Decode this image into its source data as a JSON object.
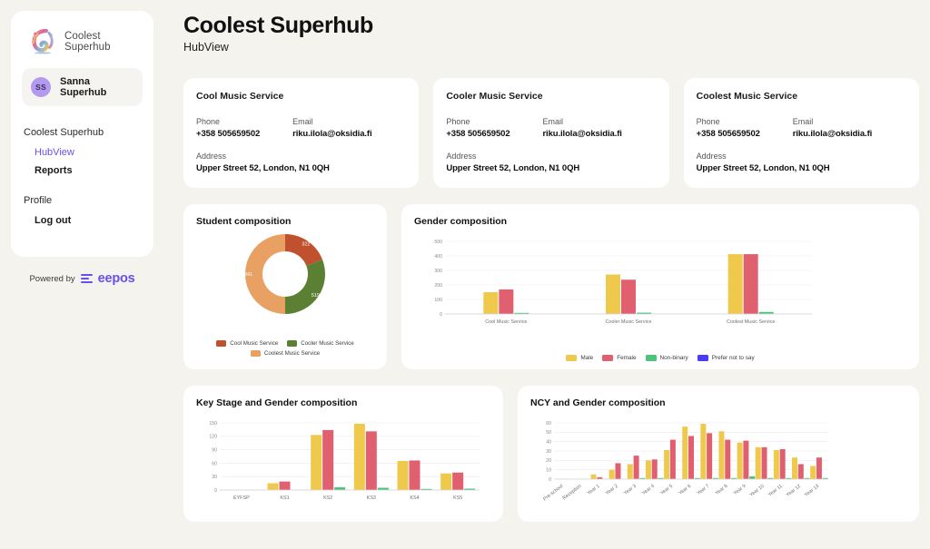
{
  "sidebar": {
    "brand": {
      "name": "Coolest Superhub",
      "logo_icon": "superhub-swirl-logo"
    },
    "user": {
      "initials": "SS",
      "name": "Sanna Superhub"
    },
    "groups": [
      {
        "heading": "Coolest Superhub",
        "items": [
          {
            "label": "HubView",
            "active": true
          },
          {
            "label": "Reports",
            "active": false
          }
        ]
      },
      {
        "heading": "Profile",
        "items": [
          {
            "label": "Log out",
            "active": false
          }
        ]
      }
    ],
    "footer": {
      "powered_label": "Powered by",
      "vendor": "eepos",
      "vendor_color": "#6b4ef0"
    }
  },
  "header": {
    "title": "Coolest Superhub",
    "subtitle": "HubView"
  },
  "contacts": {
    "labels": {
      "phone": "Phone",
      "email": "Email",
      "address": "Address"
    },
    "cards": [
      {
        "title": "Cool Music Service",
        "phone": "+358 505659502",
        "email": "riku.ilola@oksidia.fi",
        "address": "Upper Street 52, London, N1 0QH"
      },
      {
        "title": "Cooler Music Service",
        "phone": "+358 505659502",
        "email": "riku.ilola@oksidia.fi",
        "address": "Upper Street 52, London, N1 0QH"
      },
      {
        "title": "Coolest Music Service",
        "phone": "+358 505659502",
        "email": "riku.ilola@oksidia.fi",
        "address": "Upper Street 52, London, N1 0QH"
      }
    ]
  },
  "palette": {
    "male": "#efc košik",
    "bg": "#f4f3ee",
    "card": "#ffffff",
    "accent": "#6b4ef0"
  },
  "chart_data": [
    {
      "id": "student-composition",
      "type": "pie",
      "title": "Student composition",
      "donut": true,
      "categories": [
        "Cool Music Service",
        "Cooler Music Service",
        "Coolest Music Service"
      ],
      "values": [
        322,
        519,
        841
      ],
      "colors": [
        "#c0512f",
        "#5b8033",
        "#e9a063"
      ],
      "legend_position": "bottom"
    },
    {
      "id": "gender-composition",
      "type": "bar",
      "title": "Gender composition",
      "categories": [
        "Cool Music Service",
        "Cooler Music Service",
        "Coolest Music Service"
      ],
      "series": [
        {
          "name": "Male",
          "color": "#efc94c",
          "values": [
            150,
            272,
            412
          ]
        },
        {
          "name": "Female",
          "color": "#e06070",
          "values": [
            169,
            236,
            412
          ]
        },
        {
          "name": "Non-binary",
          "color": "#4cc47c",
          "values": [
            3,
            9,
            14
          ]
        },
        {
          "name": "Prefer not to say",
          "color": "#4b3bf5",
          "values": [
            0,
            0,
            0
          ]
        }
      ],
      "ylim": [
        0,
        500
      ],
      "yticks": [
        0,
        100,
        200,
        300,
        400,
        500
      ],
      "xlabel": "",
      "ylabel": "",
      "grid": true,
      "legend_position": "bottom"
    },
    {
      "id": "key-stage-gender-composition",
      "type": "bar",
      "title": "Key Stage and Gender composition",
      "categories": [
        "EYFSP",
        "KS1",
        "KS2",
        "KS3",
        "KS4",
        "KS5"
      ],
      "series": [
        {
          "name": "Male",
          "color": "#efc94c",
          "values": [
            0,
            15,
            123,
            148,
            65,
            37
          ]
        },
        {
          "name": "Female",
          "color": "#e06070",
          "values": [
            0,
            19,
            134,
            131,
            66,
            39
          ]
        },
        {
          "name": "Non-binary",
          "color": "#4cc47c",
          "values": [
            0,
            0,
            6,
            5,
            2,
            3
          ]
        },
        {
          "name": "Prefer not to say",
          "color": "#4b3bf5",
          "values": [
            0,
            0,
            0,
            0,
            0,
            0
          ]
        }
      ],
      "ylim": [
        0,
        150
      ],
      "yticks": [
        0,
        30,
        60,
        90,
        120,
        150
      ],
      "grid": true
    },
    {
      "id": "ncy-gender-composition",
      "type": "bar",
      "title": "NCY and Gender composition",
      "categories": [
        "Pre-school",
        "Reception",
        "Year 1",
        "Year 2",
        "Year 3",
        "Year 4",
        "Year 5",
        "Year 6",
        "Year 7",
        "Year 8",
        "Year 9",
        "Year 10",
        "Year 11",
        "Year 12",
        "Year 13"
      ],
      "series": [
        {
          "name": "Male",
          "color": "#efc94c",
          "values": [
            0,
            0,
            5,
            10,
            16,
            20,
            31,
            56,
            59,
            51,
            39,
            34,
            31,
            23,
            14
          ]
        },
        {
          "name": "Female",
          "color": "#e06070",
          "values": [
            0,
            0,
            2,
            17,
            25,
            21,
            42,
            46,
            49,
            42,
            41,
            34,
            32,
            16,
            23
          ]
        },
        {
          "name": "Non-binary",
          "color": "#4cc47c",
          "values": [
            0,
            0,
            0,
            0,
            1,
            1,
            0,
            1,
            1,
            1,
            3,
            1,
            1,
            1,
            1
          ]
        },
        {
          "name": "Prefer not to say",
          "color": "#4b3bf5",
          "values": [
            0,
            0,
            0,
            0,
            0,
            0,
            0,
            0,
            0,
            0,
            0,
            0,
            0,
            0,
            0
          ]
        }
      ],
      "ylim": [
        0,
        60
      ],
      "yticks": [
        0,
        10,
        20,
        30,
        40,
        50,
        60
      ],
      "grid": true
    }
  ]
}
